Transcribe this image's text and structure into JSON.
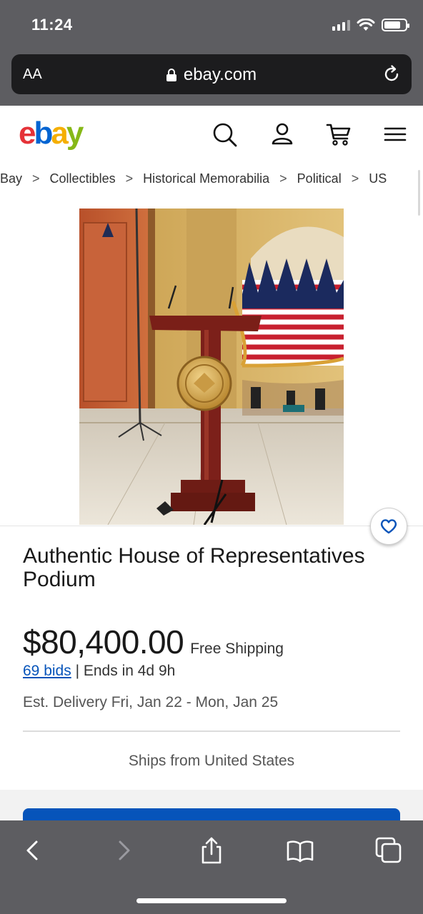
{
  "status_bar": {
    "time": "11:24"
  },
  "browser": {
    "aa_label": "AA",
    "url": "ebay.com",
    "icons": [
      "lock-icon",
      "reload-icon"
    ]
  },
  "ebay_header": {
    "logo": {
      "e": "e",
      "b": "b",
      "a": "a",
      "y": "y"
    },
    "icons": [
      "search-icon",
      "account-icon",
      "cart-icon",
      "menu-icon"
    ]
  },
  "breadcrumb": {
    "items": [
      "eBay",
      "Collectibles",
      "Historical Memorabilia",
      "Political",
      "US"
    ],
    "separator": ">"
  },
  "listing": {
    "title": "Authentic House of Representatives Podium",
    "price": "$80,400.00",
    "shipping": "Free Shipping",
    "bids": "69 bids",
    "bids_separator": "|",
    "ends": "Ends in 4d 9h",
    "delivery": "Est. Delivery Fri, Jan 22 - Mon, Jan 25",
    "ships_from": "Ships from United States"
  },
  "colors": {
    "ebay_e": "#e53238",
    "ebay_b": "#0064d2",
    "ebay_a": "#f5af02",
    "ebay_y": "#86b817",
    "link": "#0654ba",
    "buy_button": "#0654ba",
    "browser_chrome": "#5d5d61"
  },
  "toolbar": {
    "icons": [
      "back-icon",
      "forward-icon",
      "share-icon",
      "bookmarks-icon",
      "tabs-icon"
    ]
  }
}
